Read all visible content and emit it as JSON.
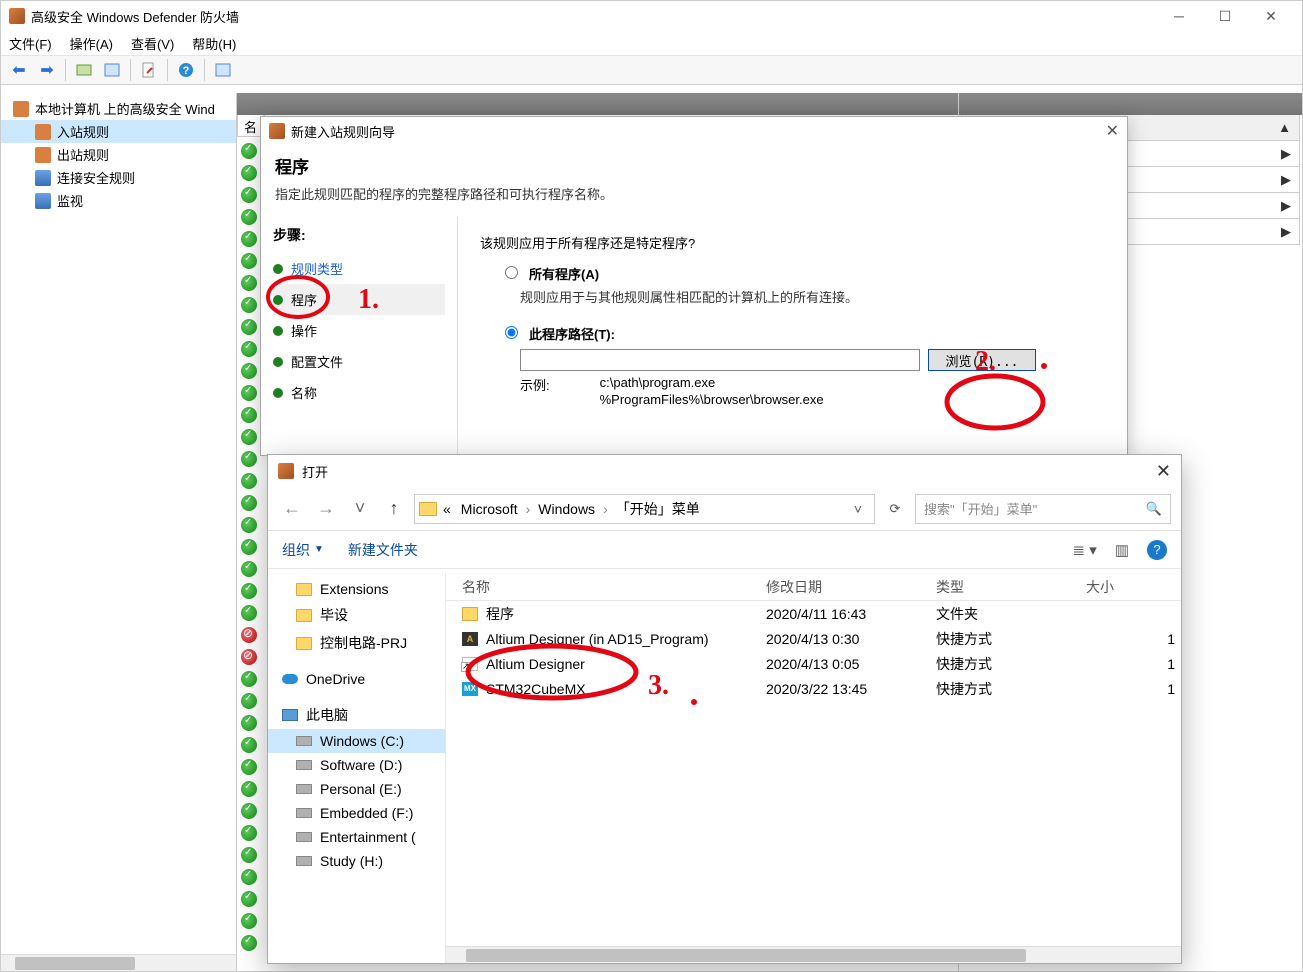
{
  "mainWindow": {
    "title": "高级安全 Windows Defender 防火墙",
    "menus": [
      "文件(F)",
      "操作(A)",
      "查看(V)",
      "帮助(H)"
    ]
  },
  "tree": {
    "root": "本地计算机 上的高级安全 Wind",
    "items": [
      "入站规则",
      "出站规则",
      "连接安全规则",
      "监视"
    ]
  },
  "midHeader": {
    "col1": "名"
  },
  "rightPane": {
    "rows": [
      "▲",
      "▶",
      "▶",
      "▶",
      "▶"
    ]
  },
  "wizard": {
    "title": "新建入站规则向导",
    "heading": "程序",
    "subtitle": "指定此规则匹配的程序的完整程序路径和可执行程序名称。",
    "stepsLabel": "步骤:",
    "steps": [
      "规则类型",
      "程序",
      "操作",
      "配置文件",
      "名称"
    ],
    "question": "该规则应用于所有程序还是特定程序?",
    "optAll": "所有程序(A)",
    "optAllDesc": "规则应用于与其他规则属性相匹配的计算机上的所有连接。",
    "optPath": "此程序路径(T):",
    "pathValue": "",
    "browse": "浏览(R)...",
    "exampleLabel": "示例:",
    "example1": "c:\\path\\program.exe",
    "example2": "%ProgramFiles%\\browser\\browser.exe"
  },
  "fileOpen": {
    "title": "打开",
    "breadcrumb": [
      "Microsoft",
      "Windows",
      "「开始」菜单"
    ],
    "bcPrefix": "«",
    "searchPlaceholder": "搜索\"「开始」菜单\"",
    "organize": "组织",
    "newFolder": "新建文件夹",
    "columns": {
      "name": "名称",
      "date": "修改日期",
      "type": "类型",
      "size": "大小"
    },
    "side": {
      "folders": [
        "Extensions",
        "毕设",
        "控制电路-PRJ"
      ],
      "oneDrive": "OneDrive",
      "thisPC": "此电脑",
      "drives": [
        "Windows (C:)",
        "Software (D:)",
        "Personal (E:)",
        "Embedded (F:)",
        "Entertainment (",
        "Study (H:)"
      ]
    },
    "rows": [
      {
        "name": "程序",
        "date": "2020/4/11 16:43",
        "type": "文件夹",
        "size": "",
        "icon": "folder"
      },
      {
        "name": "Altium Designer (in AD15_Program)",
        "date": "2020/4/13 0:30",
        "type": "快捷方式",
        "size": "1",
        "icon": "ad"
      },
      {
        "name": "Altium Designer",
        "date": "2020/4/13 0:05",
        "type": "快捷方式",
        "size": "1",
        "icon": "shortcut"
      },
      {
        "name": "STM32CubeMX",
        "date": "2020/3/22 13:45",
        "type": "快捷方式",
        "size": "1",
        "icon": "mx"
      }
    ]
  },
  "annotations": {
    "n1": "1.",
    "n2": "2.",
    "n3": "3."
  }
}
